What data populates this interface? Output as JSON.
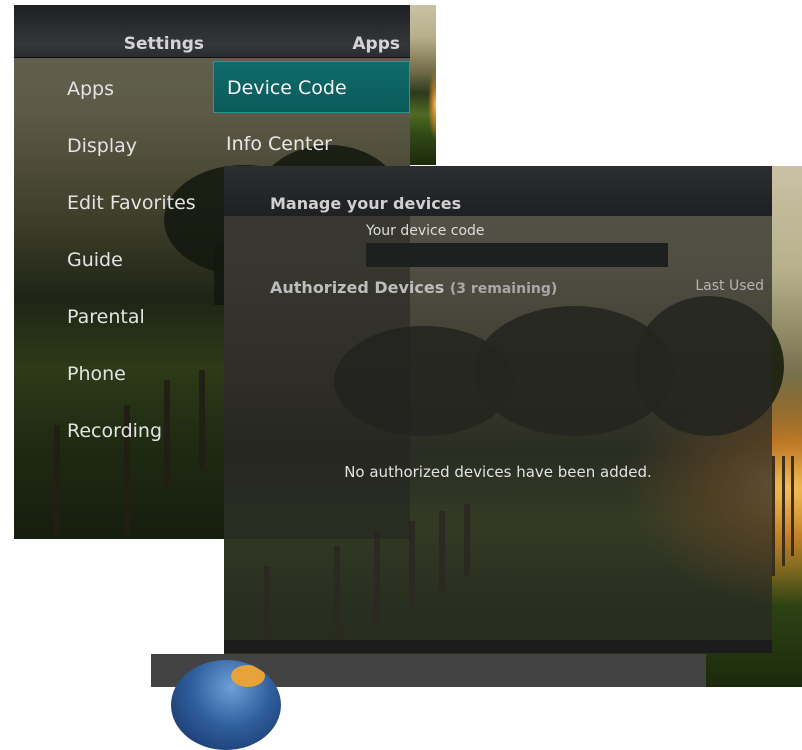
{
  "settings": {
    "header_left": "Settings",
    "header_right": "Apps",
    "categories": [
      "Apps",
      "Display",
      "Edit Favorites",
      "Guide",
      "Parental",
      "Phone",
      "Recording"
    ],
    "sub_items": [
      "Device Code",
      "Info Center"
    ]
  },
  "devices": {
    "title": "Manage your devices",
    "code_label": "Your device code",
    "authorized_title": "Authorized Devices",
    "remaining": "(3 remaining)",
    "last_used": "Last Used",
    "empty_message": "No authorized devices have been added."
  },
  "icons": {
    "bottom_panel_icon": "globe-icon"
  },
  "colors": {
    "selected_accent": "#0f6b6a",
    "header_dark": "#2b2d30"
  }
}
